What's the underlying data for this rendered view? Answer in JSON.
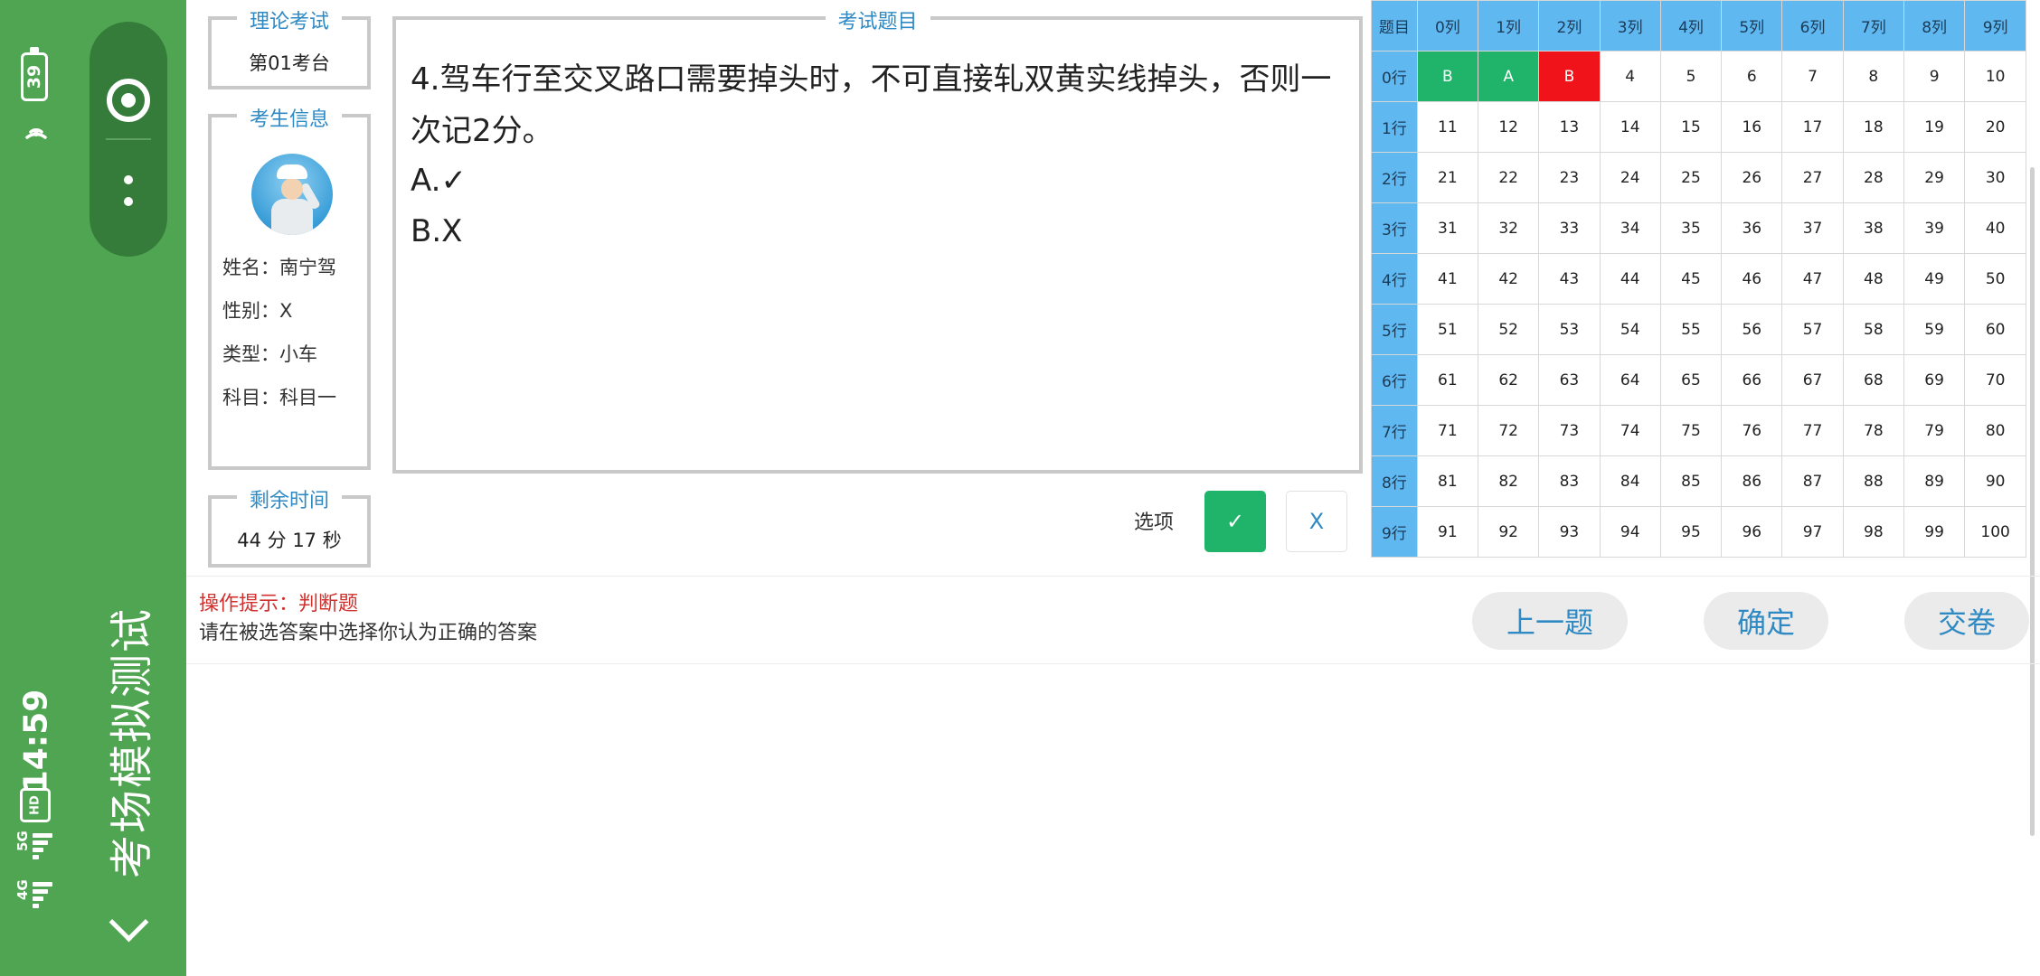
{
  "status_bar": {
    "battery": "39",
    "time": "14:59",
    "hd_badge": "HD",
    "signal_1": "5G",
    "signal_2": "4G"
  },
  "app": {
    "title": "考场模拟测试"
  },
  "exam": {
    "legend": "理论考试",
    "station": "第01考台"
  },
  "candidate": {
    "legend": "考生信息",
    "name": "姓名：南宁驾",
    "gender": "性别：X",
    "type": "类型：小车",
    "subject": "科目：科目一"
  },
  "timer": {
    "legend": "剩余时间",
    "value": "44 分 17 秒"
  },
  "question": {
    "legend": "考试题目",
    "text": "4.驾车行至交叉路口需要掉头时，不可直接轧双黄实线掉头，否则一次记2分。",
    "option_a": "A.✓",
    "option_b": "B.X"
  },
  "answer": {
    "label": "选项",
    "true_symbol": "✓",
    "false_symbol": "X"
  },
  "grid": {
    "corner": "题目",
    "columns": [
      "0列",
      "1列",
      "2列",
      "3列",
      "4列",
      "5列",
      "6列",
      "7列",
      "8列",
      "9列"
    ],
    "rows": [
      {
        "label": "0行",
        "cells": [
          {
            "v": "B",
            "s": "correct"
          },
          {
            "v": "A",
            "s": "correct"
          },
          {
            "v": "B",
            "s": "wrong"
          },
          {
            "v": "4"
          },
          {
            "v": "5"
          },
          {
            "v": "6"
          },
          {
            "v": "7"
          },
          {
            "v": "8"
          },
          {
            "v": "9"
          },
          {
            "v": "10"
          }
        ]
      },
      {
        "label": "1行",
        "cells": [
          {
            "v": "11"
          },
          {
            "v": "12"
          },
          {
            "v": "13"
          },
          {
            "v": "14"
          },
          {
            "v": "15"
          },
          {
            "v": "16"
          },
          {
            "v": "17"
          },
          {
            "v": "18"
          },
          {
            "v": "19"
          },
          {
            "v": "20"
          }
        ]
      },
      {
        "label": "2行",
        "cells": [
          {
            "v": "21"
          },
          {
            "v": "22"
          },
          {
            "v": "23"
          },
          {
            "v": "24"
          },
          {
            "v": "25"
          },
          {
            "v": "26"
          },
          {
            "v": "27"
          },
          {
            "v": "28"
          },
          {
            "v": "29"
          },
          {
            "v": "30"
          }
        ]
      },
      {
        "label": "3行",
        "cells": [
          {
            "v": "31"
          },
          {
            "v": "32"
          },
          {
            "v": "33"
          },
          {
            "v": "34"
          },
          {
            "v": "35"
          },
          {
            "v": "36"
          },
          {
            "v": "37"
          },
          {
            "v": "38"
          },
          {
            "v": "39"
          },
          {
            "v": "40"
          }
        ]
      },
      {
        "label": "4行",
        "cells": [
          {
            "v": "41"
          },
          {
            "v": "42"
          },
          {
            "v": "43"
          },
          {
            "v": "44"
          },
          {
            "v": "45"
          },
          {
            "v": "46"
          },
          {
            "v": "47"
          },
          {
            "v": "48"
          },
          {
            "v": "49"
          },
          {
            "v": "50"
          }
        ]
      },
      {
        "label": "5行",
        "cells": [
          {
            "v": "51"
          },
          {
            "v": "52"
          },
          {
            "v": "53"
          },
          {
            "v": "54"
          },
          {
            "v": "55"
          },
          {
            "v": "56"
          },
          {
            "v": "57"
          },
          {
            "v": "58"
          },
          {
            "v": "59"
          },
          {
            "v": "60"
          }
        ]
      },
      {
        "label": "6行",
        "cells": [
          {
            "v": "61"
          },
          {
            "v": "62"
          },
          {
            "v": "63"
          },
          {
            "v": "64"
          },
          {
            "v": "65"
          },
          {
            "v": "66"
          },
          {
            "v": "67"
          },
          {
            "v": "68"
          },
          {
            "v": "69"
          },
          {
            "v": "70"
          }
        ]
      },
      {
        "label": "7行",
        "cells": [
          {
            "v": "71"
          },
          {
            "v": "72"
          },
          {
            "v": "73"
          },
          {
            "v": "74"
          },
          {
            "v": "75"
          },
          {
            "v": "76"
          },
          {
            "v": "77"
          },
          {
            "v": "78"
          },
          {
            "v": "79"
          },
          {
            "v": "80"
          }
        ]
      },
      {
        "label": "8行",
        "cells": [
          {
            "v": "81"
          },
          {
            "v": "82"
          },
          {
            "v": "83"
          },
          {
            "v": "84"
          },
          {
            "v": "85"
          },
          {
            "v": "86"
          },
          {
            "v": "87"
          },
          {
            "v": "88"
          },
          {
            "v": "89"
          },
          {
            "v": "90"
          }
        ]
      },
      {
        "label": "9行",
        "cells": [
          {
            "v": "91"
          },
          {
            "v": "92"
          },
          {
            "v": "93"
          },
          {
            "v": "94"
          },
          {
            "v": "95"
          },
          {
            "v": "96"
          },
          {
            "v": "97"
          },
          {
            "v": "98"
          },
          {
            "v": "99"
          },
          {
            "v": "100"
          }
        ]
      }
    ]
  },
  "hint": {
    "title": "操作提示：判断题",
    "text": "请在被选答案中选择你认为正确的答案"
  },
  "actions": {
    "prev": "上一题",
    "confirm": "确定",
    "submit": "交卷"
  },
  "colors": {
    "sidebar": "#50a552",
    "capsule": "#357c3a",
    "accent_blue": "#2f8ac4",
    "header_blue": "#60b8f1",
    "correct": "#1fb46a",
    "wrong": "#f0141a",
    "hint_red": "#d0322f"
  },
  "icons": {
    "battery": "battery-icon",
    "wifi": "wifi-icon",
    "target": "target-icon",
    "more": "more-dots-icon",
    "back": "chevron-down-icon"
  }
}
